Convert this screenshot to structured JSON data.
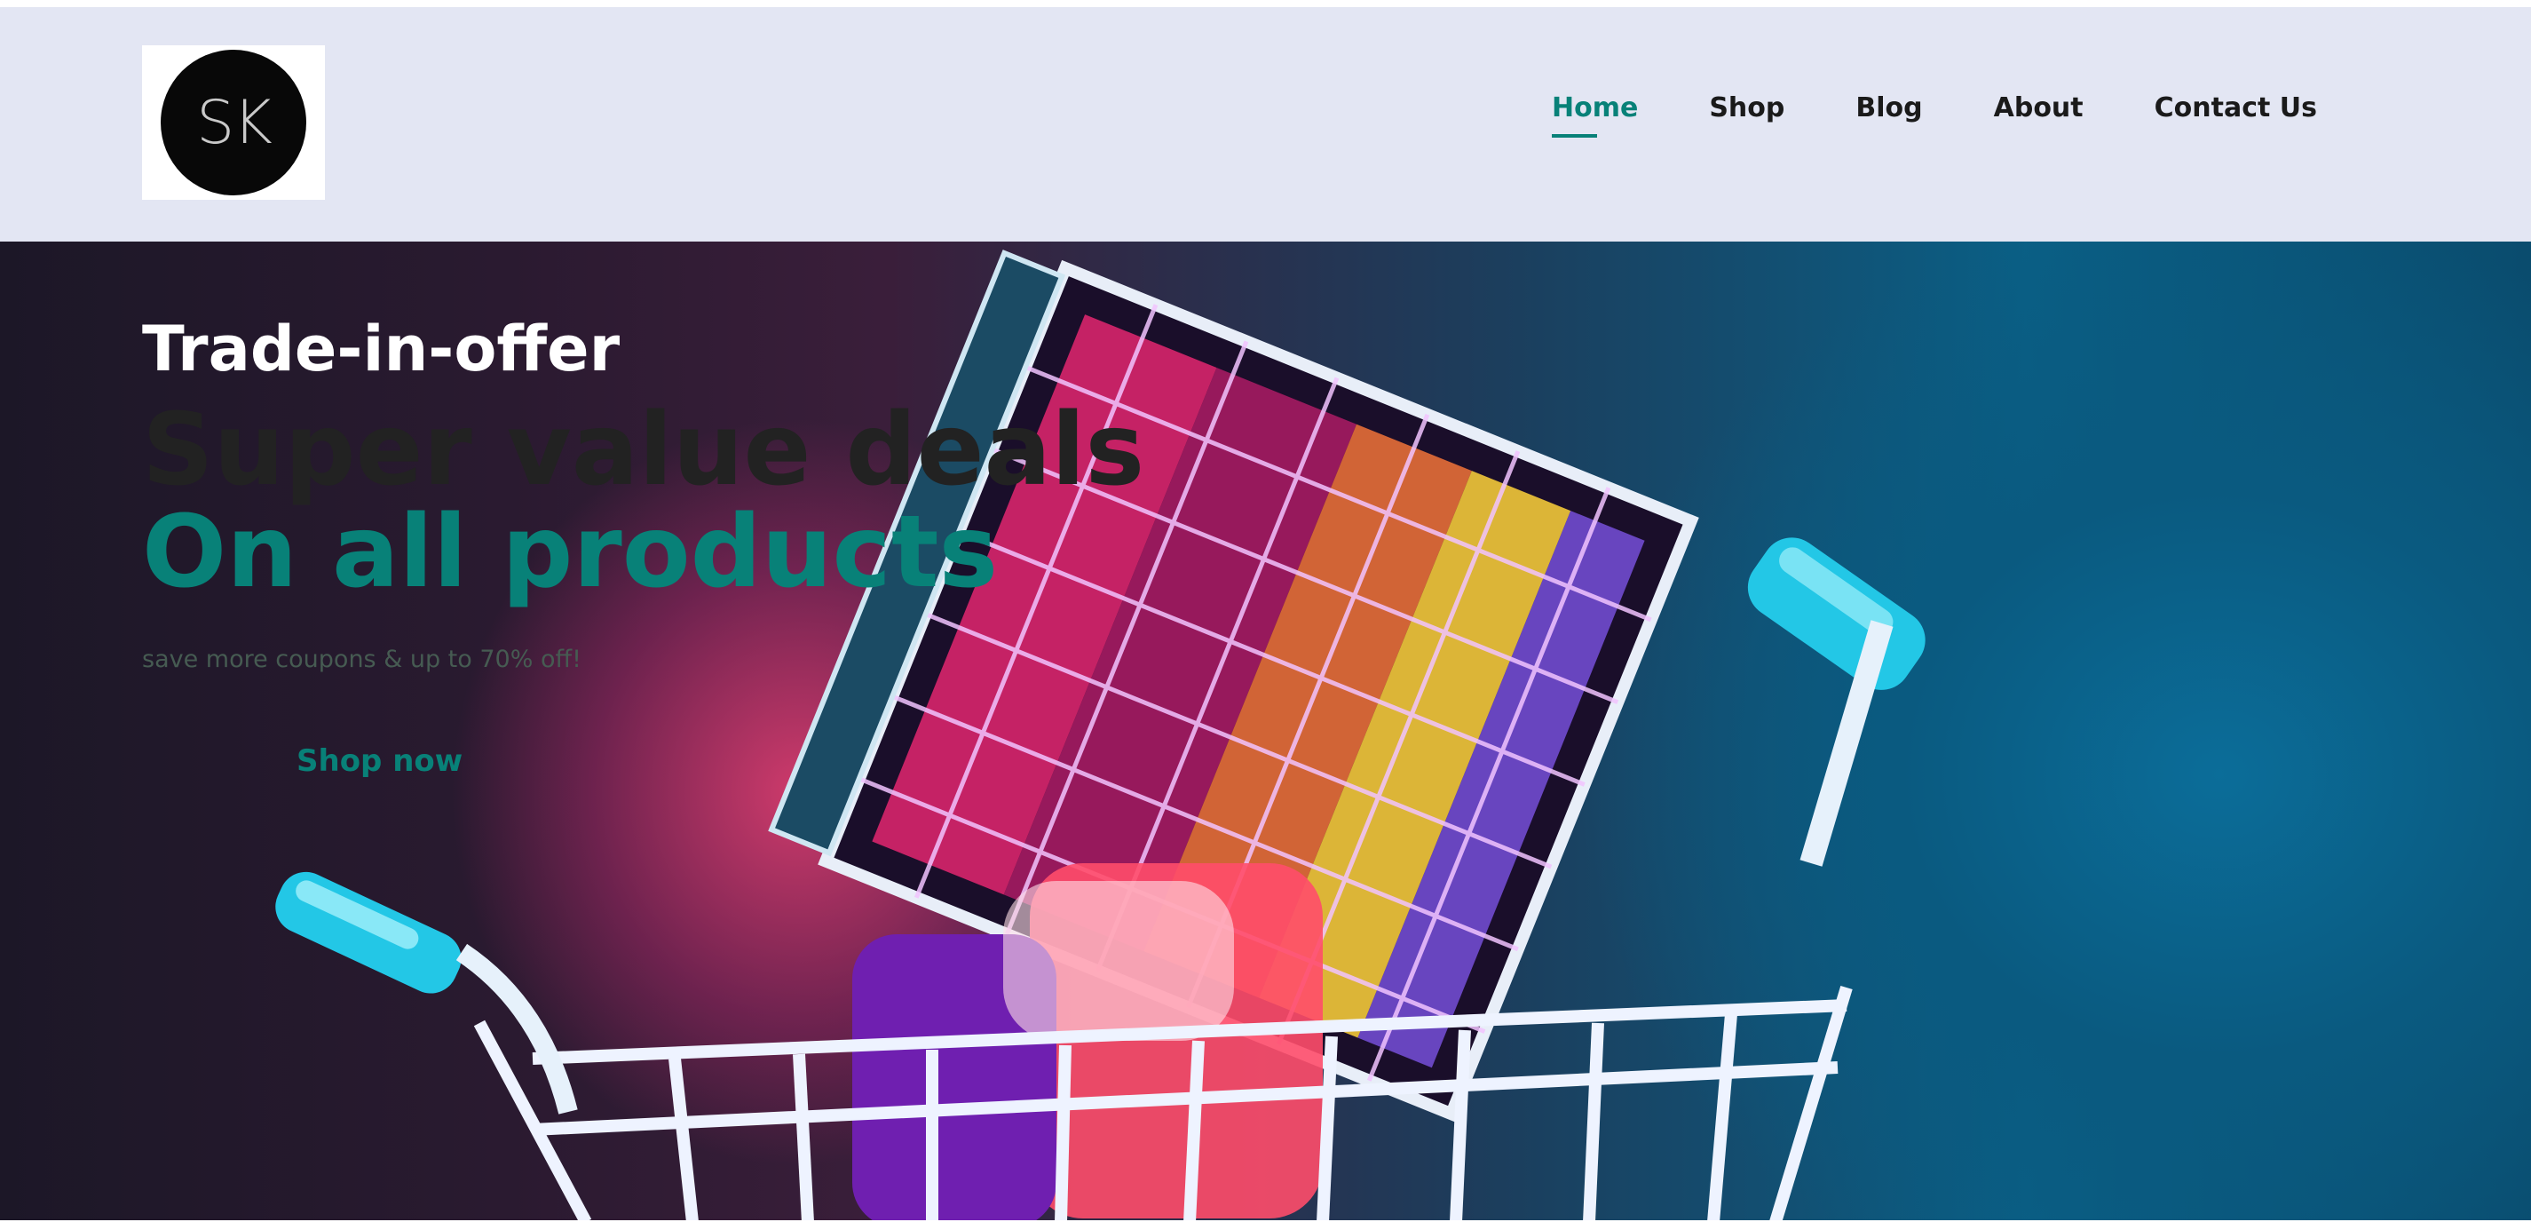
{
  "header": {
    "logo_text": "SK",
    "nav": [
      {
        "label": "Home",
        "active": true
      },
      {
        "label": "Shop",
        "active": false
      },
      {
        "label": "Blog",
        "active": false
      },
      {
        "label": "About",
        "active": false
      },
      {
        "label": "Contact Us",
        "active": false
      }
    ]
  },
  "hero": {
    "kicker": "Trade-in-offer",
    "headline_1": "Super value deals",
    "headline_2": "On all products",
    "subtext": "save more coupons & up to 70% off!",
    "cta_label": "Shop now",
    "background_image": "shopping-cart-icon"
  },
  "colors": {
    "accent": "#088178",
    "header_bg": "#e3e6f3",
    "nav_text": "#1a1a1a",
    "headline_dark": "#222222",
    "subtext": "#465b52"
  }
}
